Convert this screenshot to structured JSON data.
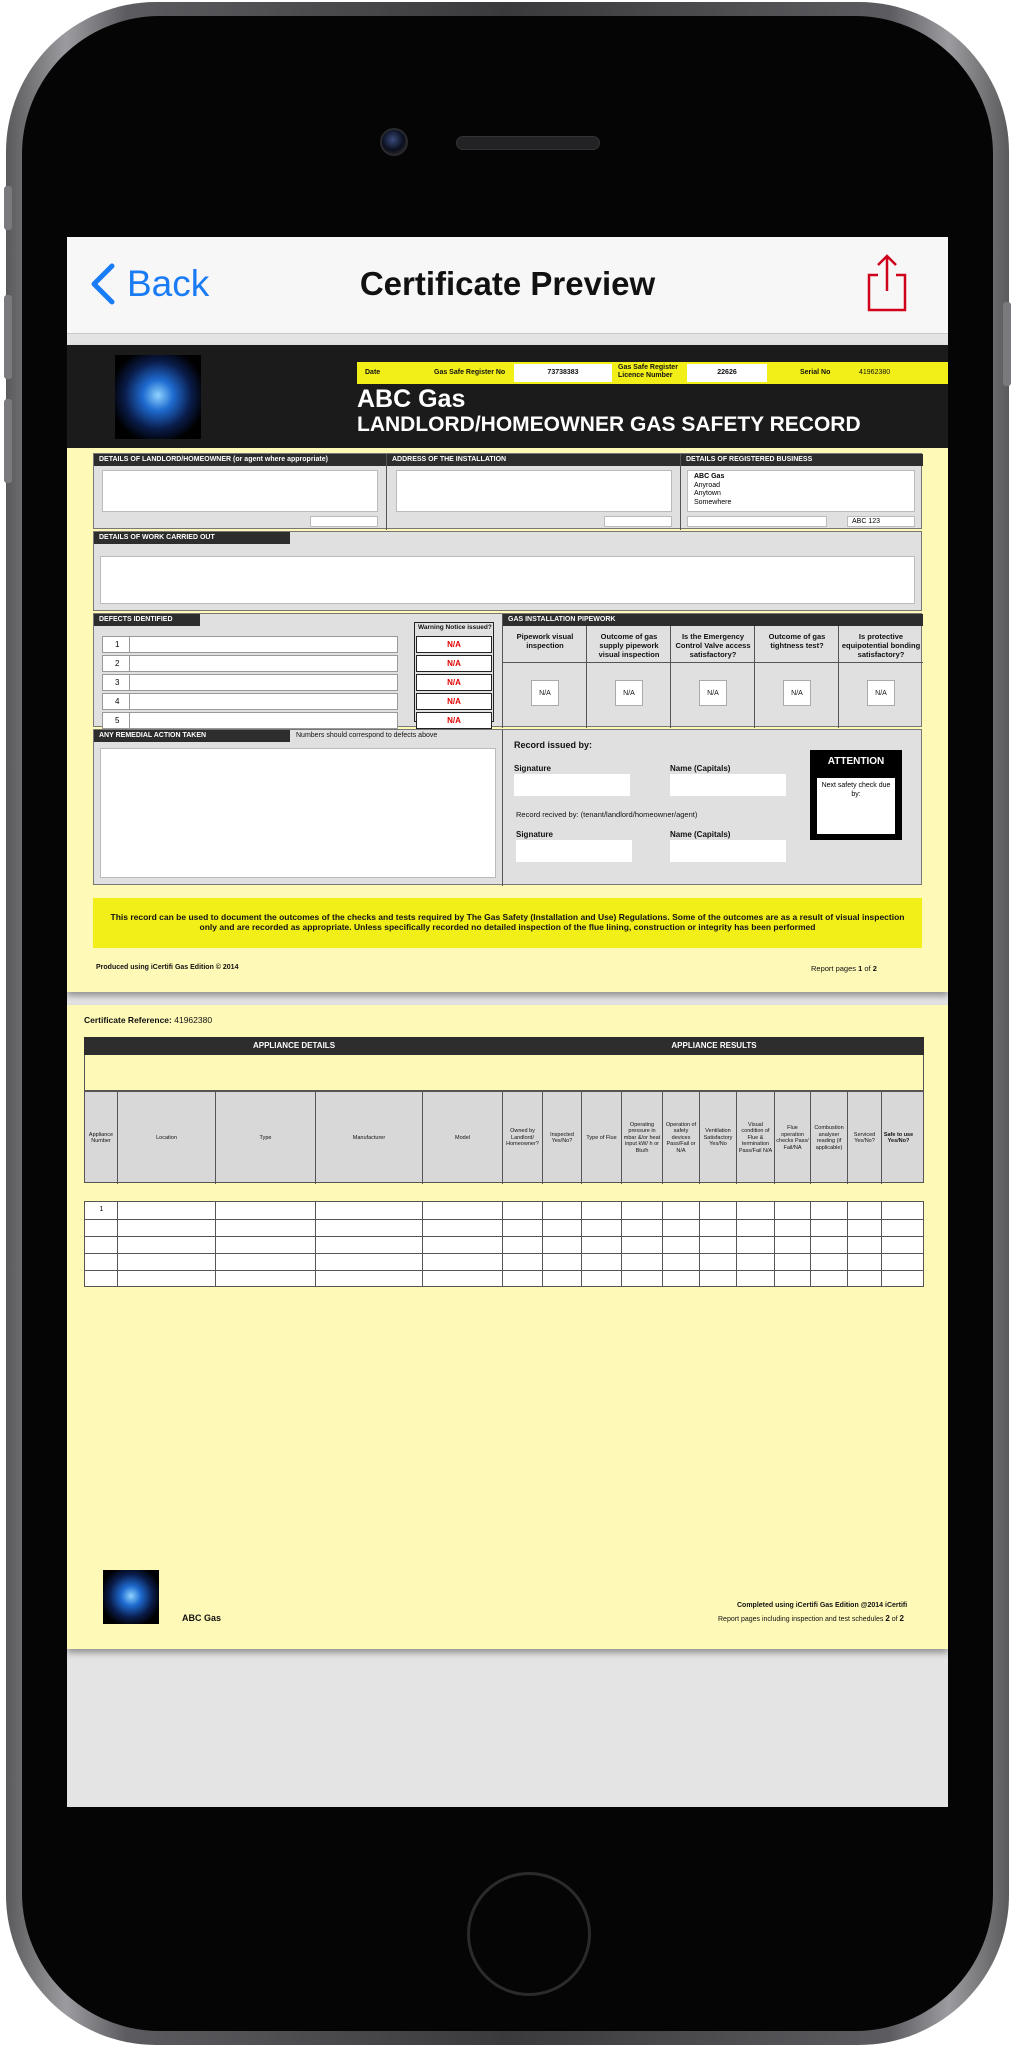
{
  "nav": {
    "back_label": "Back",
    "title": "Certificate Preview"
  },
  "page1": {
    "header": {
      "date_label": "Date",
      "register_label": "Gas Safe Register No",
      "register_value": "73738383",
      "licence_label": "Gas Safe Register Licence Number",
      "licence_value": "22626",
      "serial_label": "Serial No",
      "serial_value": "41962380",
      "company": "ABC Gas",
      "doc_title": "LANDLORD/HOMEOWNER GAS SAFETY RECORD"
    },
    "landlord_label": "DETAILS OF LANDLORD/HOMEOWNER (or agent where appropriate)",
    "address_label": "ADDRESS OF THE INSTALLATION",
    "business_label": "DETAILS OF REGISTERED BUSINESS",
    "business_lines": [
      "ABC Gas",
      "Anyroad",
      "Anytown",
      "Somewhere"
    ],
    "business_postcode": "ABC 123",
    "work_label": "DETAILS OF WORK CARRIED OUT",
    "defects_label": "DEFECTS IDENTIFIED",
    "defect_numbers": [
      "1",
      "2",
      "3",
      "4",
      "5"
    ],
    "warning_label": "Warning Notice issued?",
    "warning_values": [
      "N/A",
      "N/A",
      "N/A",
      "N/A",
      "N/A"
    ],
    "pipework_label": "GAS INSTALLATION PIPEWORK",
    "pipework_questions": [
      "Pipework visual inspection",
      "Outcome of gas supply pipework visual inspection",
      "Is the Emergency Control Valve access satisfactory?",
      "Outcome of gas tightness test?",
      "Is protective equipotential bonding satisfactory?"
    ],
    "pipework_answers": [
      "N/A",
      "N/A",
      "N/A",
      "N/A",
      "N/A"
    ],
    "remedial_label": "ANY REMEDIAL ACTION TAKEN",
    "remedial_note": "Numbers should correspond to defects above",
    "record_issued_label": "Record issued by:",
    "signature_label": "Signature",
    "name_label": "Name (Capitals)",
    "received_label": "Record recived by: (tenant/landlord/homeowner/agent)",
    "signature2_label": "Signature",
    "name2_label": "Name (Capitals)",
    "attention_title": "ATTENTION",
    "attention_text": "Next safety check due by:",
    "disclaimer": "This record can be used to document the outcomes of the checks and tests required by The Gas Safety (Installation and Use) Regulations.  Some of the outcomes are as a result of visual inspection only and are recorded as appropriate. Unless specifically recorded no detailed inspection of the flue lining, construction or integrity has been performed",
    "produced": "Produced using iCertifi Gas Edition © 2014",
    "report_pages_label": "Report pages",
    "report_page": "1",
    "report_of": "of",
    "report_total": "2"
  },
  "page2": {
    "cert_ref_label": "Certificate Reference:",
    "cert_ref_value": "41962380",
    "appliance_details": "APPLIANCE DETAILS",
    "appliance_results": "APPLIANCE RESULTS",
    "columns": [
      "Appliance Number",
      "Location",
      "Type",
      "Manufacturer",
      "Model",
      "Owned by Landlord/ Homeowner?",
      "Inspected Yes/No?",
      "Type of Flue",
      "Operating pressure in mbar &/or heat input kW/ h or Btu/h",
      "Operation of safety devices Pass/Fail or N/A",
      "Ventilation Satisfactory Yes/No",
      "Visual condition of Flue & termination Pass/Fail N/A",
      "Flue operation checks Pass/ Fail/NA",
      "Combustion analyser reading (if applicable)",
      "Serviced Yes/No?",
      "Safe to use Yes/No?"
    ],
    "row_numbers": [
      "1",
      "",
      "",
      "",
      ""
    ],
    "footer_company": "ABC Gas",
    "completed": "Completed using iCertifi Gas Edition @2014 iCertifi",
    "report_pages_label": "Report pages including inspection and test schedules",
    "report_page": "2",
    "report_of": "of",
    "report_total": "2"
  },
  "colors": {
    "ios_blue": "#1a7cf5",
    "share_red": "#d0021b",
    "yellow": "#f2ef18",
    "paper": "#fff9b8",
    "dark": "#1b1b1b"
  }
}
